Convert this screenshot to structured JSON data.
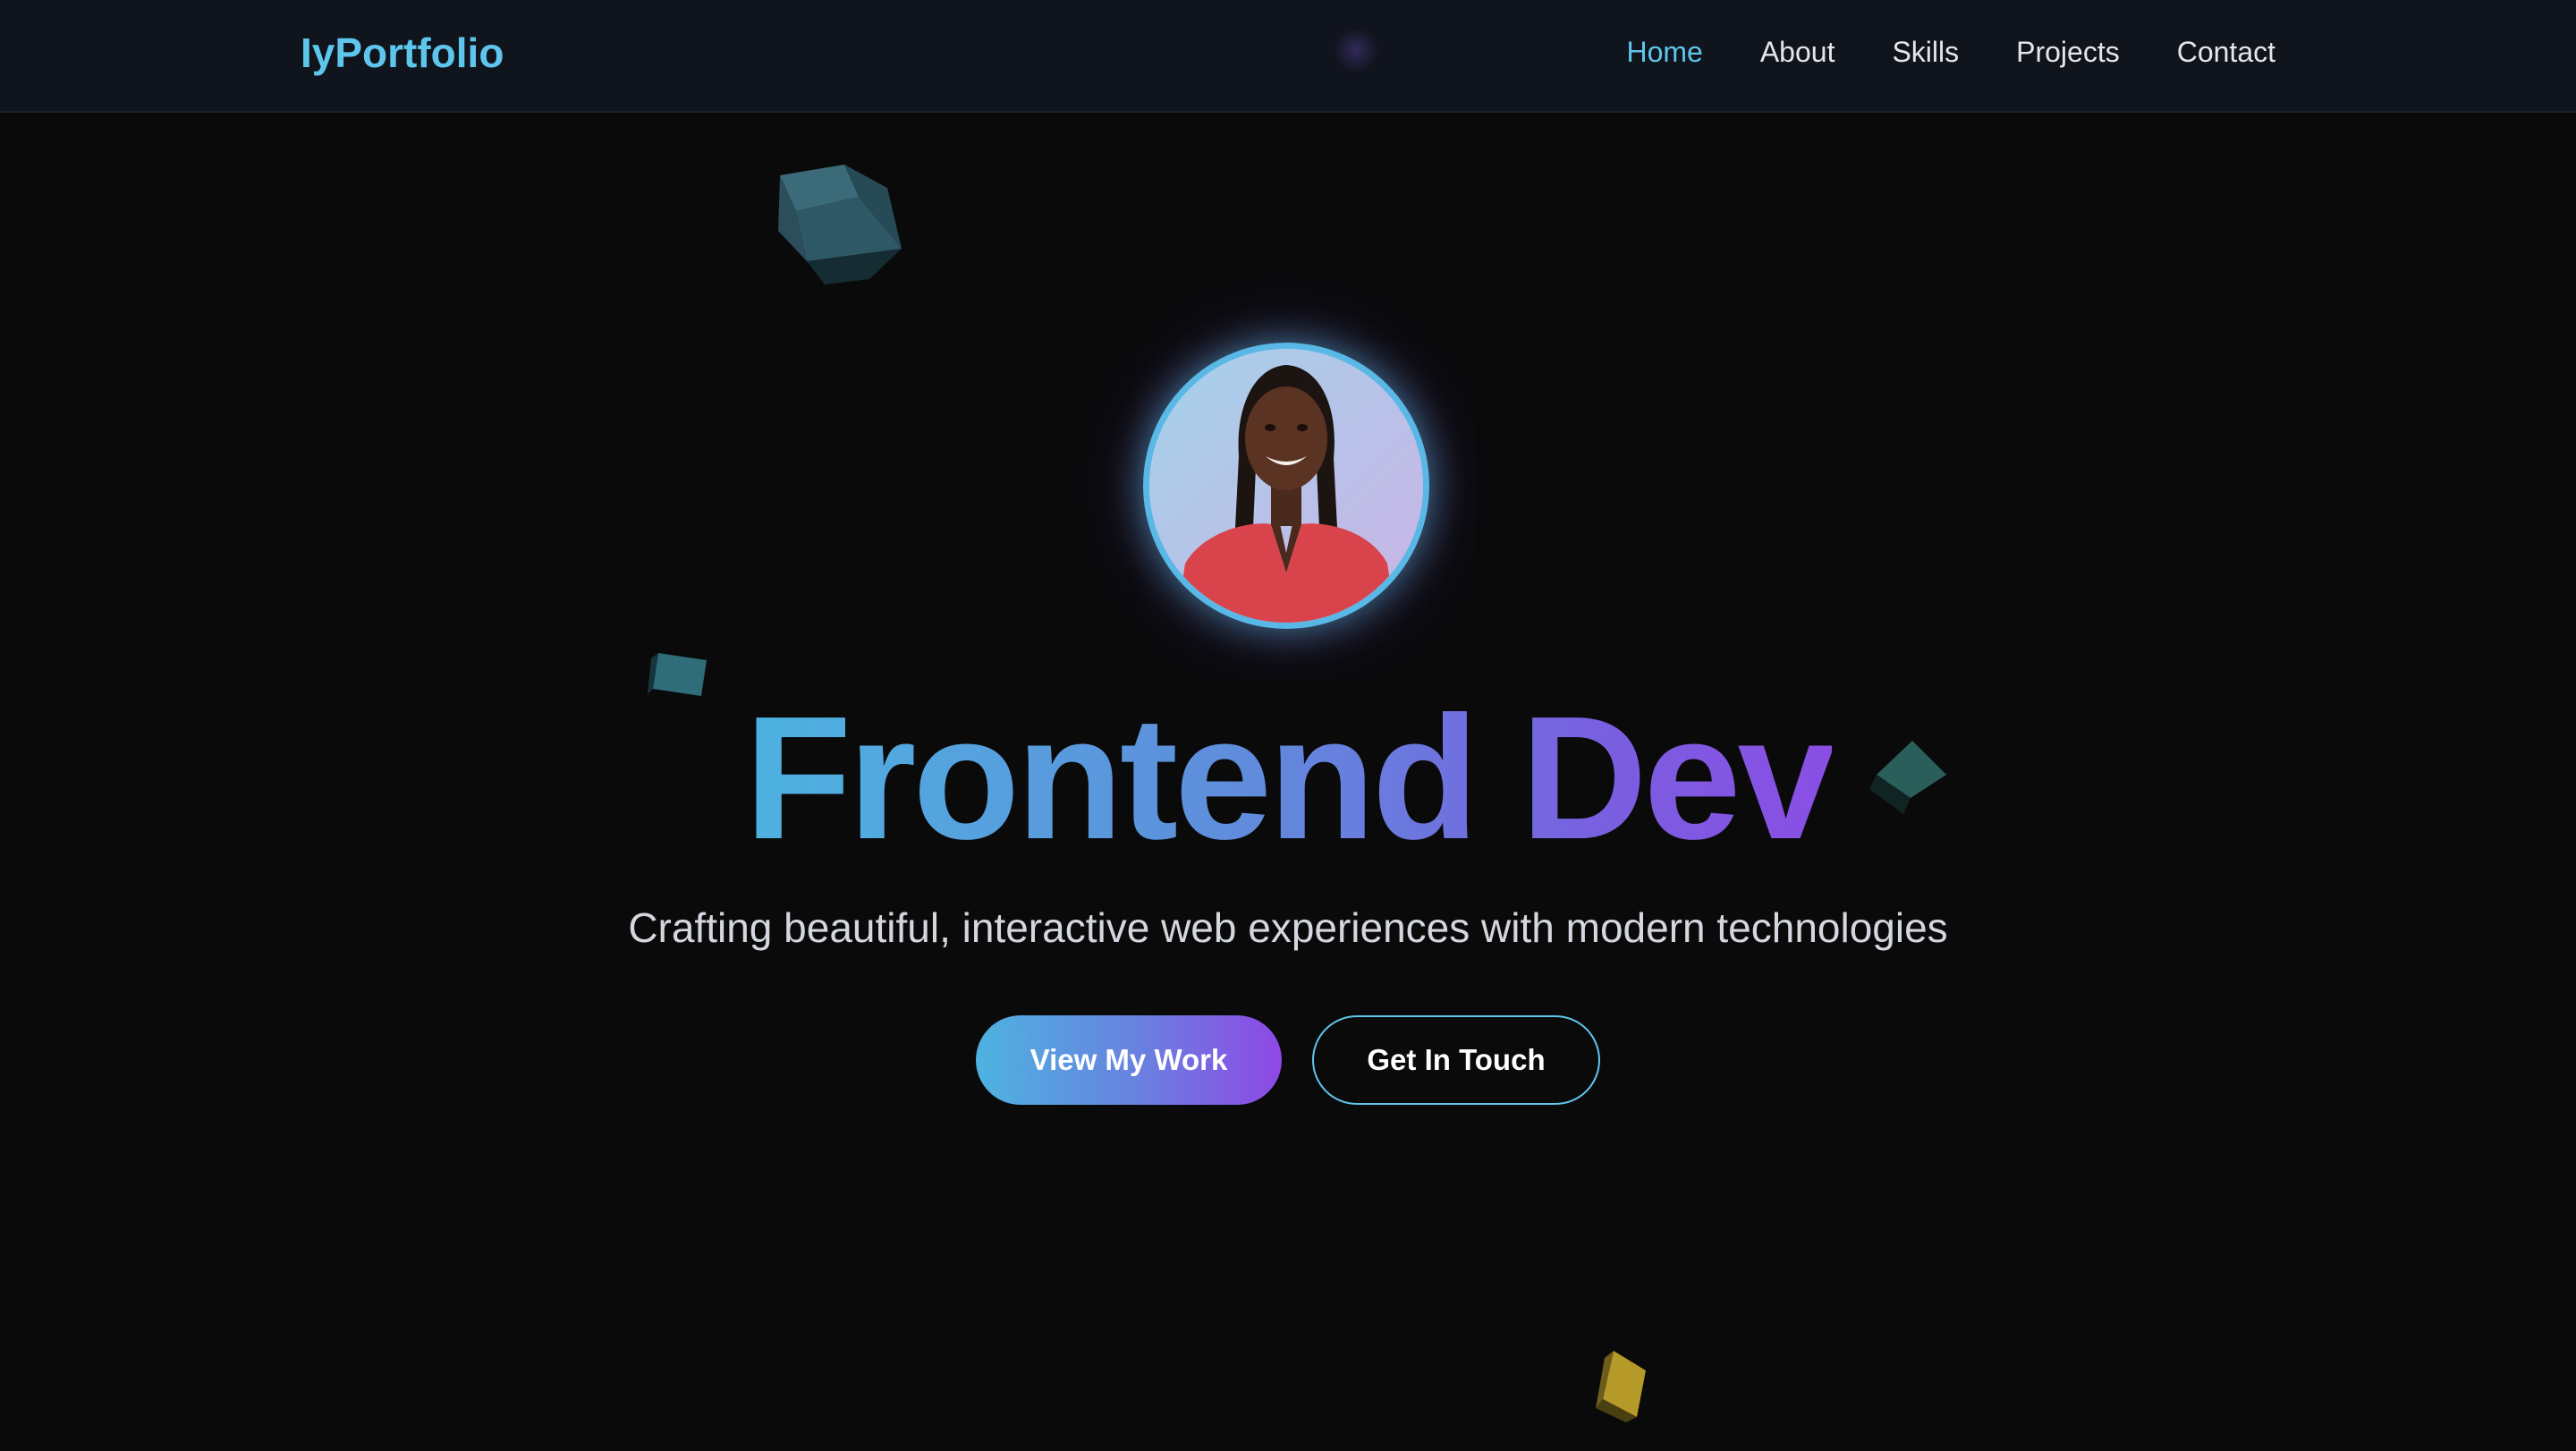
{
  "navbar": {
    "brand": "IyPortfolio",
    "links": [
      {
        "label": "Home",
        "active": true
      },
      {
        "label": "About",
        "active": false
      },
      {
        "label": "Skills",
        "active": false
      },
      {
        "label": "Projects",
        "active": false
      },
      {
        "label": "Contact",
        "active": false
      }
    ]
  },
  "hero": {
    "title": "Frontend Dev",
    "subtitle": "Crafting beautiful, interactive web experiences with modern technologies",
    "primary_button": "View My Work",
    "secondary_button": "Get In Touch"
  },
  "colors": {
    "background": "#0a0a0b",
    "navbar_background": "#10141d",
    "accent_cyan": "#5ec6ec",
    "accent_purple": "#8e48e6",
    "cube_teal": "#2d5a66",
    "cube_gold": "#b59a2a"
  },
  "icons": {
    "avatar": "profile-photo"
  }
}
